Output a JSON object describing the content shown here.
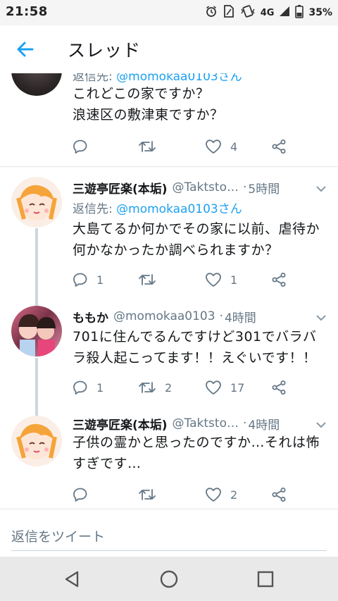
{
  "status_bar": {
    "time": "21:58",
    "network": "4G",
    "battery": "35%",
    "icons": [
      "alarm-icon",
      "sim-icon",
      "vibrate-icon",
      "signal-icon",
      "battery-icon"
    ]
  },
  "header": {
    "title": "スレッド",
    "back_icon": "arrow-left-icon"
  },
  "colors": {
    "accent": "#1da1f2",
    "muted_text": "#657786",
    "text": "#14171a",
    "divider": "#e1e8ed"
  },
  "tweets": [
    {
      "partial": true,
      "reply_to_label": "返信先: ",
      "reply_to_handle": "@momokaa0103さん",
      "body_lines": [
        "これどこの家ですか？",
        "浪速区の敷津東ですか？"
      ],
      "reply_count": "",
      "retweet_count": "",
      "like_count": "4"
    },
    {
      "name": "三遊亭匠楽(本垢)",
      "handle": "@Taktsto…",
      "time_ago": "5時間",
      "reply_to_label": "返信先: ",
      "reply_to_handle": "@momokaa0103さん",
      "body_lines": [
        "大島てるか何かでその家に以前、虐待か",
        "何かなかったか調べられますか？"
      ],
      "reply_count": "1",
      "retweet_count": "",
      "like_count": "1"
    },
    {
      "name": "ももか",
      "handle": "@momokaa0103",
      "time_ago": "4時間",
      "body_lines": [
        "701に住んでるんですけど301でバラバ",
        "ラ殺人起こってます！！えぐいです！！"
      ],
      "reply_count": "1",
      "retweet_count": "2",
      "like_count": "17"
    },
    {
      "name": "三遊亭匠楽(本垢)",
      "handle": "@Taktsto…",
      "time_ago": "4時間",
      "body_lines": [
        "子供の霊かと思ったのですか…それは怖",
        "すぎです…"
      ],
      "reply_count": "",
      "retweet_count": "",
      "like_count": "2"
    }
  ],
  "dot_separator": "·",
  "composer": {
    "placeholder": "返信をツイート"
  },
  "nav": {
    "back": "triangle-back-icon",
    "home": "circle-home-icon",
    "recents": "square-recents-icon"
  }
}
